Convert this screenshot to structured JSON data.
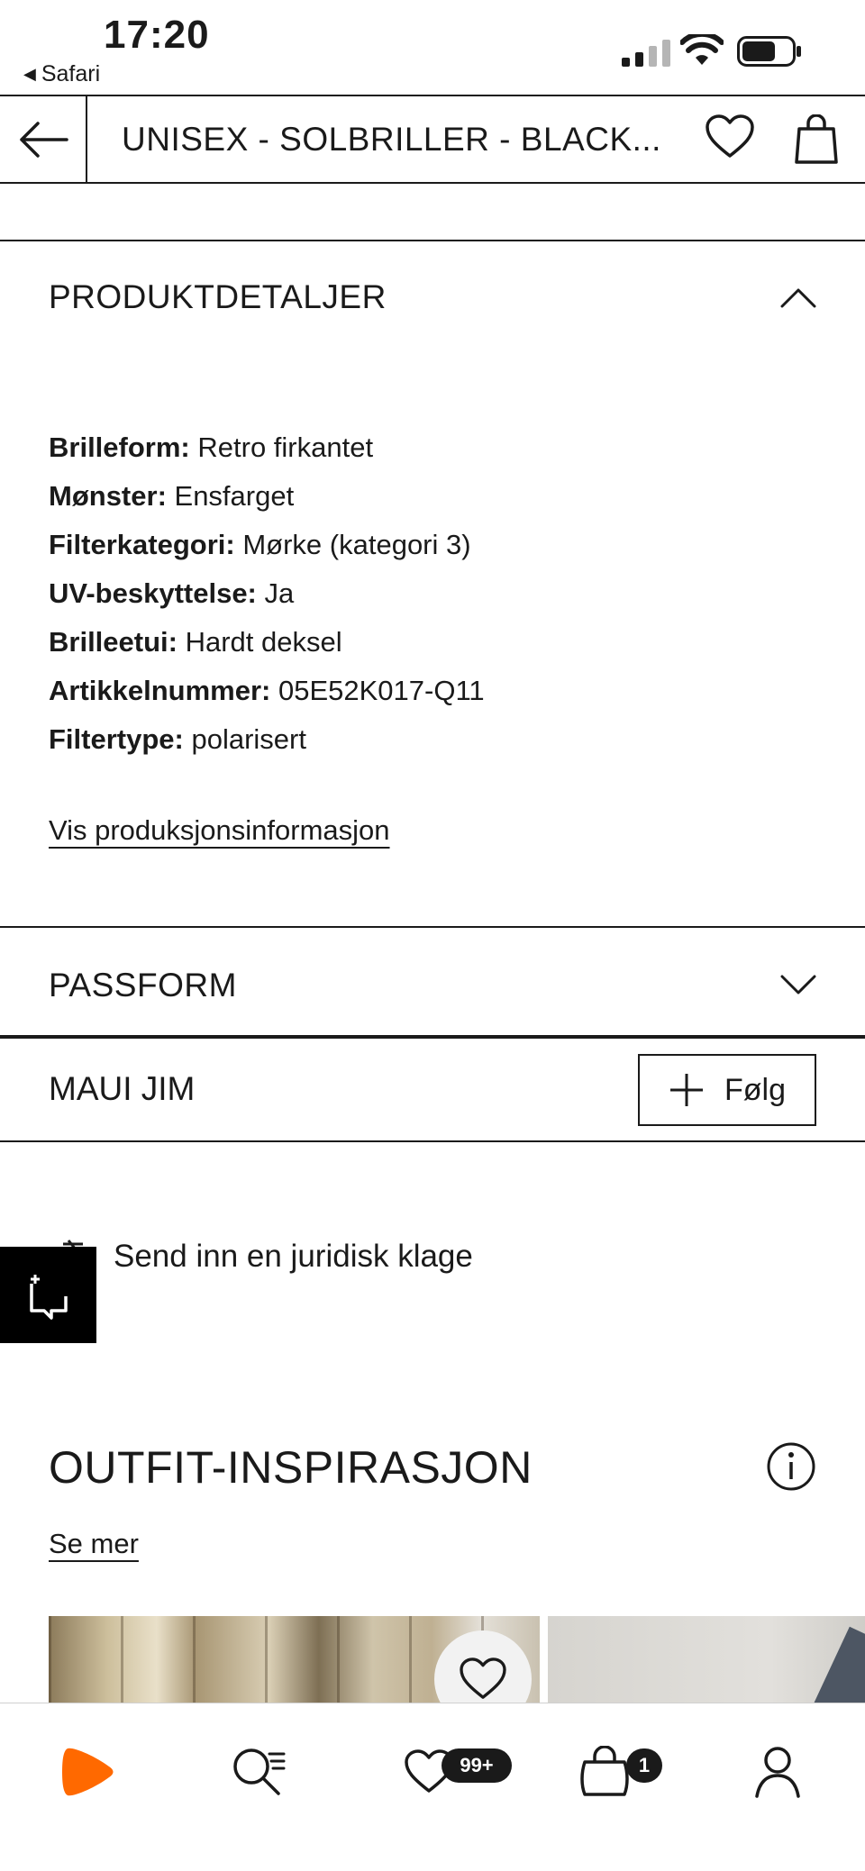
{
  "status_bar": {
    "time": "17:20",
    "back_app": "Safari"
  },
  "header": {
    "title": "UNISEX - SOLBRILLER - BLACK..."
  },
  "product_details": {
    "title": "PRODUKTDETALJER",
    "rows": [
      {
        "label": "Brilleform:",
        "value": "Retro firkantet"
      },
      {
        "label": "Mønster:",
        "value": "Ensfarget"
      },
      {
        "label": "Filterkategori:",
        "value": "Mørke (kategori 3)"
      },
      {
        "label": "UV-beskyttelse:",
        "value": "Ja"
      },
      {
        "label": "Brilleetui:",
        "value": "Hardt deksel"
      },
      {
        "label": "Artikkelnummer:",
        "value": "05E52K017-Q11"
      },
      {
        "label": "Filtertype:",
        "value": "polarisert"
      }
    ],
    "production_link": "Vis produksjonsinformasjon"
  },
  "fit": {
    "title": "PASSFORM"
  },
  "brand": {
    "name": "MAUI JIM",
    "follow_label": "Følg"
  },
  "legal": {
    "label": "Send inn en juridisk klage"
  },
  "outfit": {
    "title": "OUTFIT-INSPIRASJON",
    "see_more": "Se mer"
  },
  "bottom_nav": {
    "wishlist_badge": "99+",
    "cart_badge": "1"
  },
  "colors": {
    "brand_orange": "#ff6900",
    "text": "#1a1a1a"
  }
}
